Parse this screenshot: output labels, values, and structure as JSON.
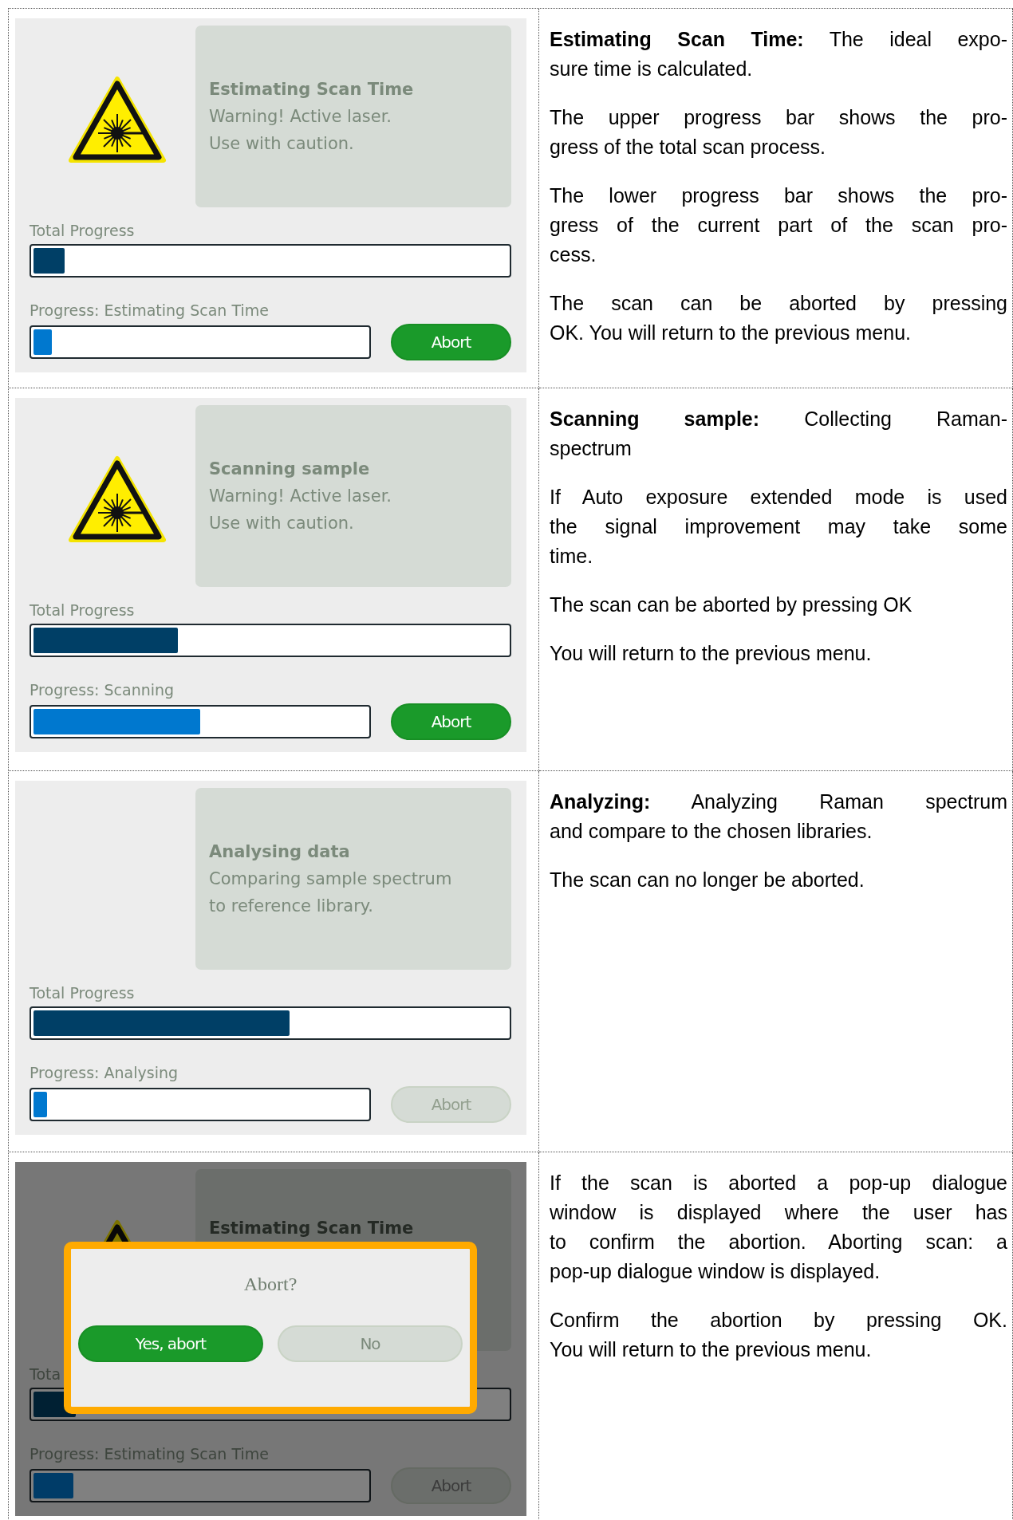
{
  "rows": [
    {
      "screen": {
        "warning_icon": true,
        "title": "Estimating Scan Time",
        "message": [
          "Warning! Active laser.",
          "Use with caution."
        ],
        "total_label": "Total Progress",
        "total": {
          "level": 0.065
        },
        "progress_label": "Progress: Estimating Scan Time",
        "progress": {
          "level": 0.055
        },
        "abort_button": {
          "label": "Abort",
          "disabled": false
        },
        "dimmed": false
      },
      "description": [
        [
          "**Estimating Scan Time:** The ideal expo-",
          "sure time is calculated."
        ],
        [
          "The upper progress bar shows the pro-",
          "gress of the total scan process."
        ],
        [
          "The lower progress bar shows the pro-",
          "gress of the current part of the scan pro-",
          "cess."
        ],
        [
          "The scan can be aborted by pressing",
          "OK. You will return to the previous menu."
        ]
      ]
    },
    {
      "screen": {
        "warning_icon": true,
        "title": "Scanning sample",
        "message": [
          "Warning! Active laser.",
          "Use with caution."
        ],
        "total_label": "Total Progress",
        "total": {
          "level": 0.305
        },
        "progress_label": "Progress: Scanning",
        "progress": {
          "level": 0.5
        },
        "abort_button": {
          "label": "Abort",
          "disabled": false
        },
        "dimmed": false
      },
      "description": [
        [
          "**Scanning sample:** Collecting Raman-",
          "spectrum"
        ],
        [
          "If Auto exposure extended mode is used",
          "the signal improvement may take some",
          "time."
        ],
        [
          "The scan can be aborted by pressing OK"
        ],
        [
          "You will return to the previous menu."
        ]
      ]
    },
    {
      "screen": {
        "warning_icon": false,
        "title": "Analysing data",
        "message": [
          "Comparing sample spectrum",
          "to reference library."
        ],
        "total_label": "Total Progress",
        "total": {
          "level": 0.54
        },
        "progress_label": "Progress: Analysing",
        "progress": {
          "level": 0.04
        },
        "abort_button": {
          "label": "Abort",
          "disabled": true
        },
        "dimmed": false
      },
      "description": [
        [
          "**Analyzing:** Analyzing Raman spectrum",
          "and compare to the chosen libraries."
        ],
        [
          "The scan can no longer be aborted."
        ]
      ]
    },
    {
      "screen": {
        "warning_icon": true,
        "title": "Estimating Scan Time",
        "total_label": "Tota",
        "total": {
          "level": 0.09
        },
        "progress_label": "Progress: Estimating Scan Time",
        "progress": {
          "level": 0.12
        },
        "abort_button": {
          "label": "Abort",
          "disabled": true
        },
        "dimmed": true,
        "dialog": {
          "question": "Abort?",
          "buttons": [
            {
              "label": "Yes, abort",
              "kind": "confirm"
            },
            {
              "label": "No",
              "kind": "cancel"
            }
          ]
        }
      },
      "description": [
        [
          "If the scan is aborted a pop-up dialogue",
          "window is displayed where the user has",
          "to confirm the abortion. Aborting scan: a",
          "pop-up dialogue window is displayed."
        ],
        [
          "Confirm the abortion by pressing OK.",
          "You will return to the previous menu."
        ]
      ]
    }
  ]
}
